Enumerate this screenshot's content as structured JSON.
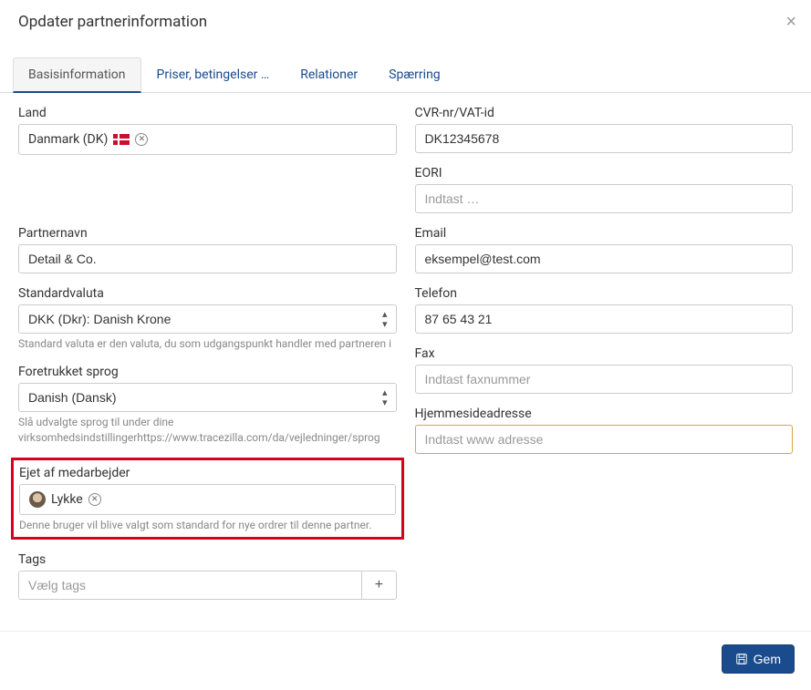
{
  "header": {
    "title": "Opdater partnerinformation"
  },
  "tabs": {
    "basis": "Basisinformation",
    "priser": "Priser, betingelser …",
    "relationer": "Relationer",
    "spaerring": "Spærring"
  },
  "fields": {
    "land": {
      "label": "Land",
      "value": "Danmark (DK)"
    },
    "cvr": {
      "label": "CVR-nr/VAT-id",
      "value": "DK12345678"
    },
    "eori": {
      "label": "EORI",
      "placeholder": "Indtast …"
    },
    "partnernavn": {
      "label": "Partnernavn",
      "value": "Detail & Co."
    },
    "email": {
      "label": "Email",
      "value": "eksempel@test.com"
    },
    "valuta": {
      "label": "Standardvaluta",
      "value": "DKK (Dkr): Danish Krone",
      "help": "Standard valuta er den valuta, du som udgangspunkt handler med partneren i"
    },
    "telefon": {
      "label": "Telefon",
      "value": "87 65 43 21"
    },
    "fax": {
      "label": "Fax",
      "placeholder": "Indtast faxnummer"
    },
    "sprog": {
      "label": "Foretrukket sprog",
      "value": "Danish (Dansk)",
      "help": "Slå udvalgte sprog til under dine virksomhedsindstillingerhttps://www.tracezilla.com/da/vejledninger/sprog"
    },
    "hjemmeside": {
      "label": "Hjemmesideadresse",
      "placeholder": "Indtast www adresse"
    },
    "ejet": {
      "label": "Ejet af medarbejder",
      "value": "Lykke",
      "help": "Denne bruger vil blive valgt som standard for nye ordrer til denne partner."
    },
    "tags": {
      "label": "Tags",
      "placeholder": "Vælg tags"
    }
  },
  "footer": {
    "save": "Gem"
  }
}
